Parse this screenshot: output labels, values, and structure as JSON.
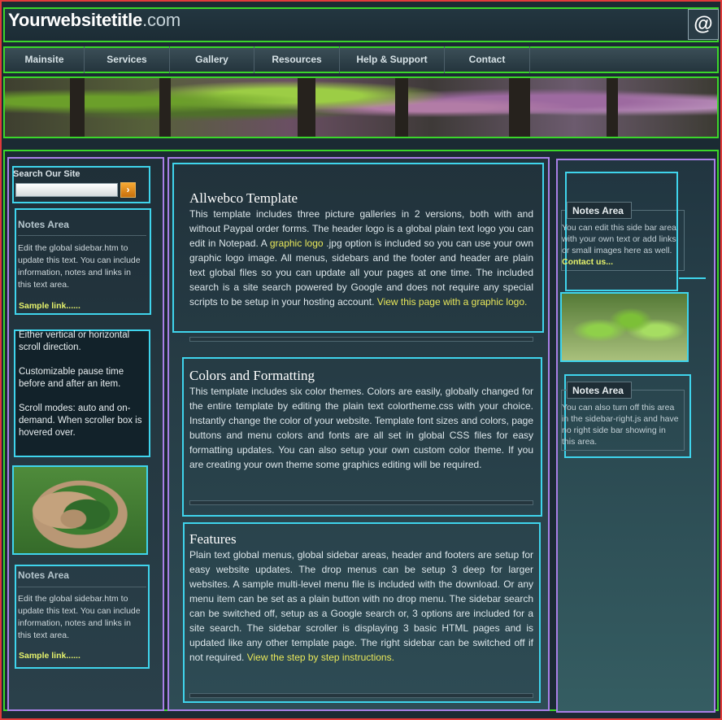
{
  "header": {
    "title": "Yourwebsitetitle",
    "title_suffix": ".com",
    "at_label": "@"
  },
  "nav": {
    "items": [
      "Mainsite",
      "Services",
      "Gallery",
      "Resources",
      "Help & Support",
      "Contact"
    ]
  },
  "search": {
    "label": "Search Our Site",
    "button": "›"
  },
  "left_notes": [
    {
      "title": "Notes Area",
      "text": "Edit the global sidebar.htm to update this text. You can include information, notes and links in this text area.",
      "link": "Sample link......"
    },
    {
      "title": "Notes Area",
      "text": "Edit the global sidebar.htm to update this text. You can include information, notes and links in this text area.",
      "link": "Sample link......"
    }
  ],
  "scroller": {
    "p1": "Either vertical or horizontal scroll direction.",
    "p2": "Customizable pause time before and after an item.",
    "p3": "Scroll modes: auto and on-demand. When scroller box is hovered over."
  },
  "articles": [
    {
      "title": "Allwebco Template",
      "t1": "This template includes three picture galleries in 2 versions, both with and without Paypal order forms. The header logo is a global plain text logo you can edit in Notepad. A ",
      "link1": "graphic logo",
      "t2": " .jpg option is included so you can use your own graphic logo image. All menus, sidebars and the footer and header are plain text global files so you can update all your pages at one time. The included search is a site search powered by Google and does not require any special scripts to be setup in your hosting account. ",
      "link2": "View this page with a graphic logo."
    },
    {
      "title": "Colors and Formatting",
      "text": "This template includes six color themes. Colors are easily, globally changed for the entire template by editing the plain text colortheme.css with your choice. Instantly change the color of your website. Template font sizes and colors, page buttons and menu colors and fonts are all set in global CSS files for easy formatting updates. You can also setup your own custom color theme. If you are creating your own theme some graphics editing will be required."
    },
    {
      "title": "Features",
      "t1": "Plain text global menus, global sidebar areas, header and footers are setup for easy website updates. The drop menus can be setup 3 deep for larger websites. A sample multi-level menu file is included with the download. Or any menu item can be set as a plain button with no drop menu. The sidebar search can be switched off, setup as a Google search or, 3 options are included for a site search. The sidebar scroller is displaying 3 basic HTML pages and is updated like any other template page. The right sidebar can be switched off if not required. ",
      "link": "View the step by step instructions."
    }
  ],
  "right_notes": [
    {
      "title": "Notes Area",
      "text": "You can edit this side bar area with your own text or add links or small images here as well. ",
      "link": "Contact us..."
    },
    {
      "title": "Notes Area",
      "text": "You can also turn off this area in the sidebar-right.js and have no right side bar showing in this area."
    }
  ]
}
